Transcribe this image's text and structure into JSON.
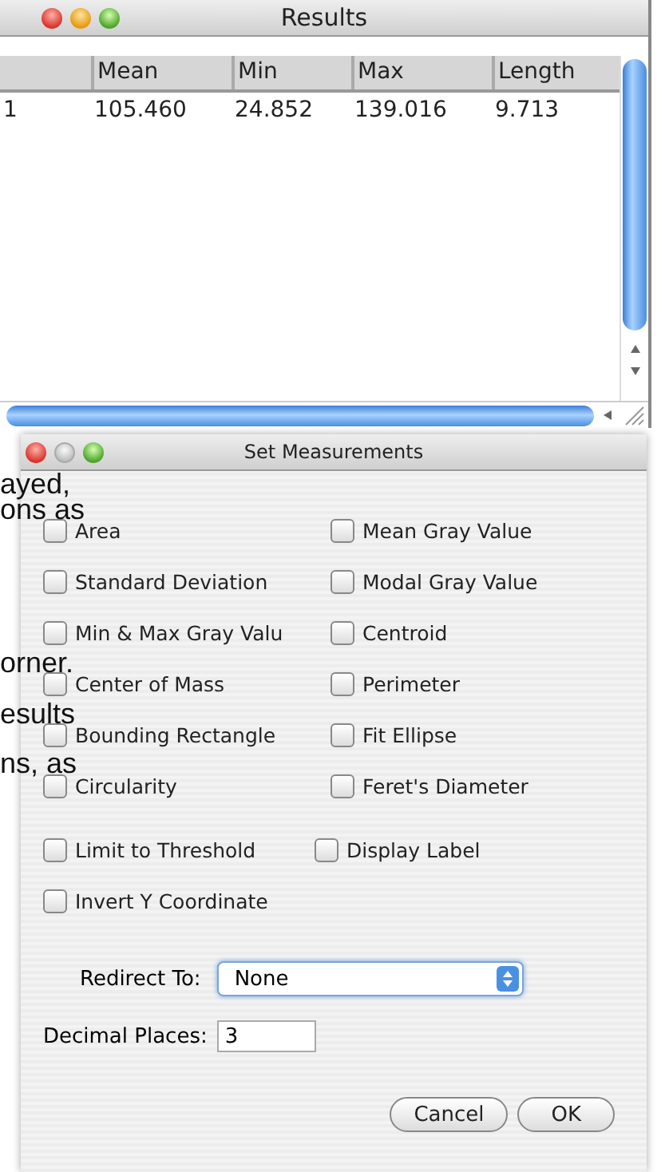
{
  "results_window": {
    "title": "Results",
    "columns": [
      "Mean",
      "Min",
      "Max",
      "Length"
    ],
    "rows": [
      {
        "index": "1",
        "cells": [
          "105.460",
          "24.852",
          "139.016",
          "9.713"
        ]
      }
    ]
  },
  "dialog": {
    "title": "Set Measurements",
    "checkbox_rows": [
      [
        {
          "label": "Area",
          "checked": false
        },
        {
          "label": "Mean Gray Value",
          "checked": false
        }
      ],
      [
        {
          "label": "Standard Deviation",
          "checked": false
        },
        {
          "label": "Modal Gray Value",
          "checked": false
        }
      ],
      [
        {
          "label": "Min & Max Gray Valu",
          "checked": false
        },
        {
          "label": "Centroid",
          "checked": false
        }
      ],
      [
        {
          "label": "Center of Mass",
          "checked": false
        },
        {
          "label": "Perimeter",
          "checked": false
        }
      ],
      [
        {
          "label": "Bounding Rectangle",
          "checked": false
        },
        {
          "label": "Fit Ellipse",
          "checked": false
        }
      ],
      [
        {
          "label": "Circularity",
          "checked": false
        },
        {
          "label": "Feret's Diameter",
          "checked": false
        }
      ]
    ],
    "extra_rows": [
      [
        {
          "label": "Limit to Threshold",
          "checked": false
        },
        {
          "label": "Display Label",
          "checked": false
        }
      ],
      [
        {
          "label": "Invert Y Coordinate",
          "checked": false
        }
      ]
    ],
    "redirect": {
      "label": "Redirect To:",
      "value": "None"
    },
    "decimal": {
      "label": "Decimal Places:",
      "value": "3"
    },
    "buttons": [
      "Cancel",
      "OK"
    ]
  },
  "background_text": [
    "ayed,",
    "ons as",
    "orner.",
    "esults",
    "ns, as"
  ]
}
